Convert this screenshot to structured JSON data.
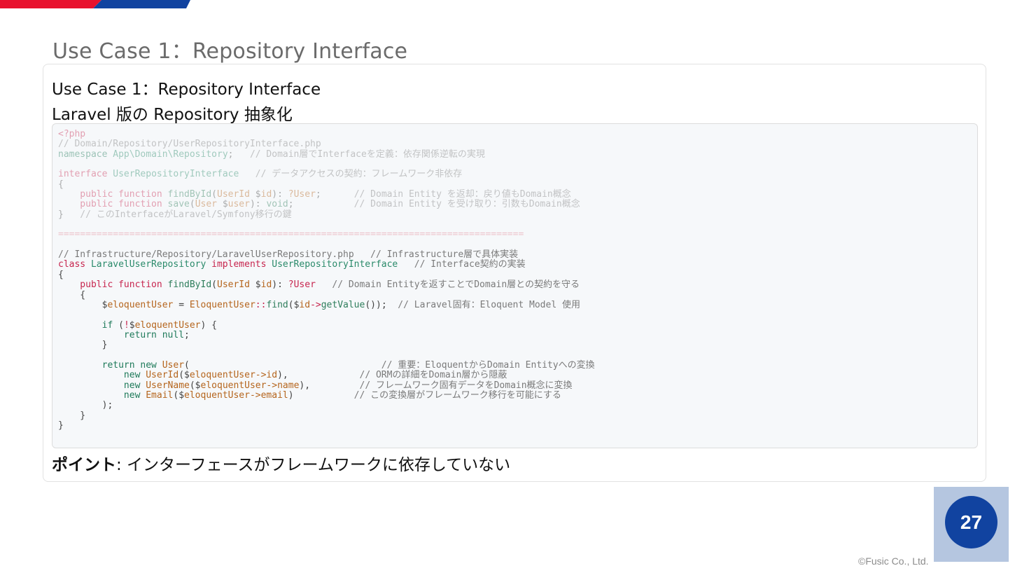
{
  "slide": {
    "title": "Use Case 1：Repository Interface",
    "page_number": "27",
    "copyright": "©Fusic Co., Ltd.",
    "colors": {
      "brand_red": "#e8112d",
      "brand_blue": "#1143a0",
      "page_box": "#b5c6e0"
    }
  },
  "card": {
    "title": "Use Case 1：Repository Interface",
    "subtitle": "Laravel 版の Repository 抽象化",
    "point_label": "ポイント",
    "point_text": ": インターフェースがフレームワークに依存していない"
  },
  "code": {
    "l1": "<?php",
    "l2": "// Domain/Repository/UserRepositoryInterface.php",
    "l3a": "namespace",
    "l3b": " App\\Domain\\Repository",
    "l3c": ";",
    "l3d": "   // Domain層でInterfaceを定義：依存関係逆転の実現",
    "l5a": "interface",
    "l5b": " UserRepositoryInterface",
    "l5c": "   // データアクセスの契約：フレームワーク非依存",
    "l6": "{",
    "l7a": "    public function",
    "l7b": " findById",
    "l7c": "(",
    "l7d": "UserId",
    "l7e": " $",
    "l7f": "id",
    "l7g": "): ",
    "l7h": "?User",
    "l7i": ";",
    "l7j": "      // Domain Entity を返却：戻り値もDomain概念",
    "l8a": "    public function",
    "l8b": " save",
    "l8c": "(",
    "l8d": "User",
    "l8e": " $",
    "l8f": "user",
    "l8g": "): ",
    "l8h": "void",
    "l8i": ";",
    "l8j": "           // Domain Entity を受け取り：引数もDomain概念",
    "l9a": "}",
    "l9b": "   // このInterfaceがLaravel/Symfony移行の鍵",
    "sep": "=====================================================================================",
    "l12": "// Infrastructure/Repository/LaravelUserRepository.php   // Infrastructure層で具体実装",
    "l13a": "class",
    "l13b": " LaravelUserRepository",
    "l13c": " implements",
    "l13d": " UserRepositoryInterface",
    "l13e": "   // Interface契約の実装",
    "l14": "{",
    "l15a": "    public function",
    "l15b": " findById",
    "l15c": "(",
    "l15d": "UserId",
    "l15e": " $",
    "l15f": "id",
    "l15g": "): ",
    "l15h": "?User",
    "l15i": "   // Domain Entityを返すことでDomain層との契約を守る",
    "l16": "    {",
    "l17a": "        $",
    "l17b": "eloquentUser",
    "l17c": " = ",
    "l17d": "EloquentUser",
    "l17e": "::",
    "l17f": "find",
    "l17g": "($",
    "l17h": "id",
    "l17i": "->",
    "l17j": "getValue",
    "l17k": "());",
    "l17l": "  // Laravel固有：Eloquent Model 使用",
    "l19a": "        if",
    "l19b": " (",
    "l19c": "!",
    "l19d": "$",
    "l19e": "eloquentUser",
    "l19f": ") {",
    "l20a": "            return",
    "l20b": " null",
    "l20c": ";",
    "l21": "        }",
    "l23a": "        return new",
    "l23b": " User",
    "l23c": "(",
    "l23d": "                                   // 重要：EloquentからDomain Entityへの変換",
    "l24a": "            new",
    "l24b": " UserId",
    "l24c": "($",
    "l24d": "eloquentUser->id",
    "l24e": "),",
    "l24f": "             // ORMの詳細をDomain層から隠蔽",
    "l25a": "            new",
    "l25b": " UserName",
    "l25c": "($",
    "l25d": "eloquentUser->name",
    "l25e": "),",
    "l25f": "         // フレームワーク固有データをDomain概念に変換",
    "l26a": "            new",
    "l26b": " Email",
    "l26c": "($",
    "l26d": "eloquentUser->email",
    "l26e": ")",
    "l26f": "           // この変換層がフレームワーク移行を可能にする",
    "l27": "        );",
    "l28": "    }",
    "l29": "}"
  }
}
